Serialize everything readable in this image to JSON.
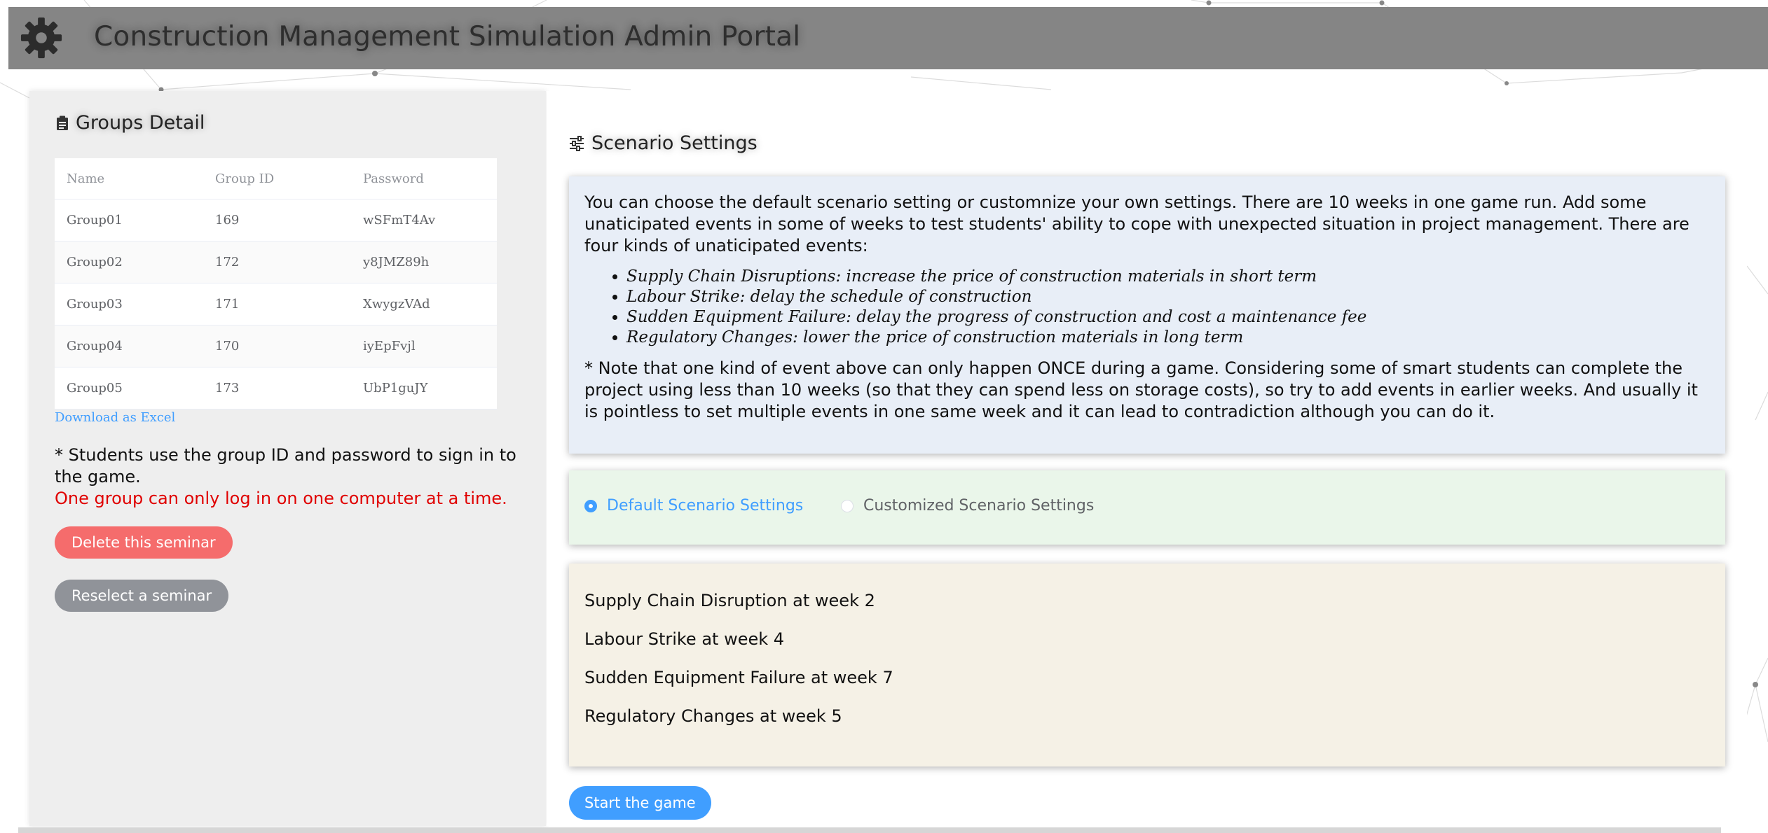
{
  "app": {
    "title": "Construction Management Simulation Admin Portal",
    "logo_icon": "gear-icon",
    "header_color": "#858585"
  },
  "groups_panel": {
    "title": "Groups Detail",
    "title_icon": "clipboard-icon",
    "columns": [
      "Name",
      "Group ID",
      "Password"
    ],
    "rows": [
      {
        "name": "Group01",
        "group_id": "169",
        "password": "wSFmT4Av"
      },
      {
        "name": "Group02",
        "group_id": "172",
        "password": "y8JMZ89h"
      },
      {
        "name": "Group03",
        "group_id": "171",
        "password": "XwygzVAd"
      },
      {
        "name": "Group04",
        "group_id": "170",
        "password": "iyEpFvjl"
      },
      {
        "name": "Group05",
        "group_id": "173",
        "password": "UbP1guJY"
      }
    ],
    "download_link": "Download as Excel",
    "note": "* Students use the group ID and password to sign in to the game.",
    "warning": "One group can only log in on one computer at a time.",
    "delete_button": "Delete this seminar",
    "reselect_button": "Reselect a seminar",
    "colors": {
      "delete": "#f56c6c",
      "reselect": "#909399",
      "warning": "#e00000",
      "link": "#409eff"
    }
  },
  "scenario_panel": {
    "title": "Scenario Settings",
    "title_icon": "sliders-icon",
    "intro": "You can choose the default scenario setting or customnize your own settings. There are 10 weeks in one game run. Add some unaticipated events in some of weeks to test students' ability to cope with unexpected situation in project management. There are four kinds of unaticipated events:",
    "event_types": [
      "Supply Chain Disruptions: increase the price of construction materials in short term",
      "Labour Strike: delay the schedule of construction",
      "Sudden Equipment Failure: delay the progress of construction and cost a maintenance fee",
      "Regulatory Changes: lower the price of construction materials in long term"
    ],
    "footnote": "* Note that one kind of event above can only happen ONCE during a game. Considering some of smart students can complete the project using less than 10 weeks (so that they can spend less on storage costs), so try to add events in earlier weeks. And usually it is pointless to set multiple events in one same week and it can lead to contradiction although you can do it.",
    "options": {
      "default_label": "Default Scenario Settings",
      "custom_label": "Customized Scenario Settings",
      "selected": "default"
    },
    "scheduled_events": [
      "Supply Chain Disruption at week 2",
      "Labour Strike at week 4",
      "Sudden Equipment Failure at week 7",
      "Regulatory Changes at week 5"
    ],
    "start_button": "Start the game",
    "colors": {
      "info_card": "#e8eef7",
      "radio_card": "#eaf6ea",
      "events_card": "#f5f1e6",
      "accent": "#409eff"
    }
  }
}
